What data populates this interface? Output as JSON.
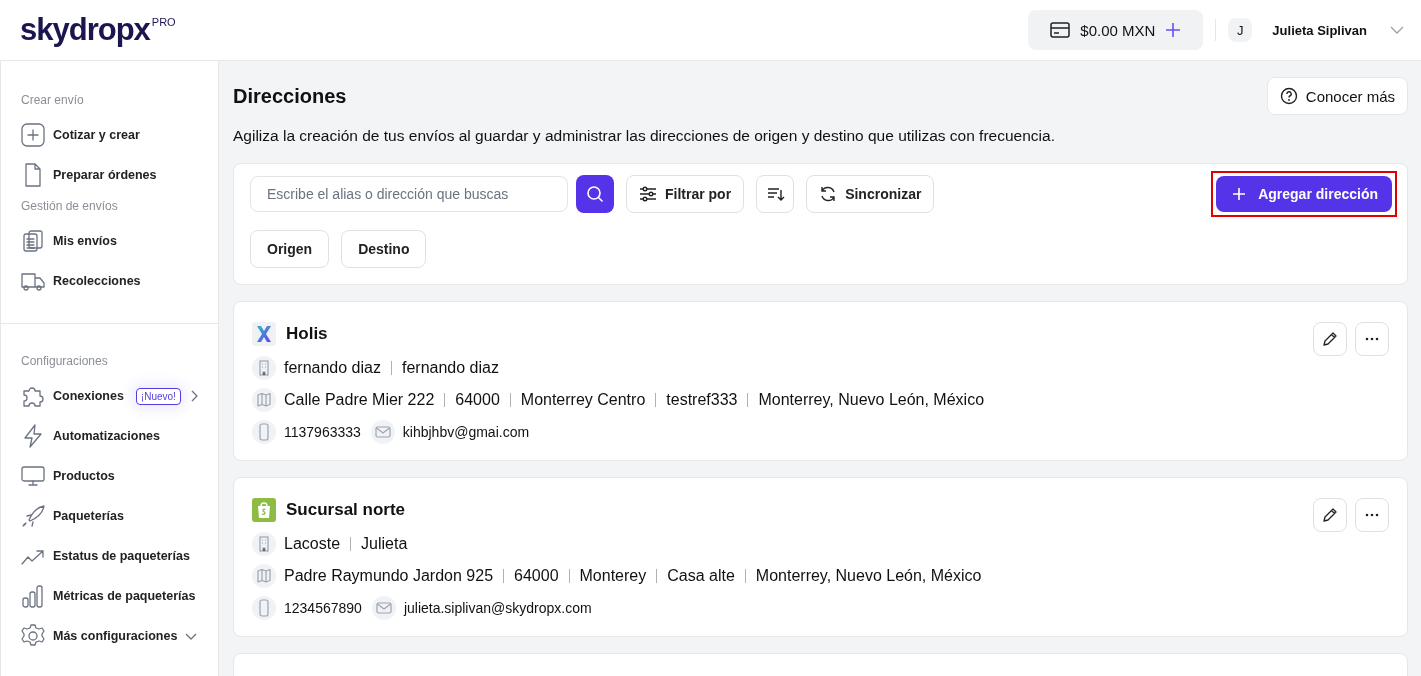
{
  "header": {
    "logo_text": "skydropx",
    "logo_badge": "PRO",
    "balance": "$0.00 MXN",
    "avatar_initial": "J",
    "user_name": "Julieta Siplivan"
  },
  "sidebar": {
    "sections": [
      {
        "title": "Crear envío",
        "items": [
          {
            "kind": "link",
            "label": "Cotizar y crear"
          },
          {
            "kind": "link",
            "label": "Preparar órdenes"
          }
        ]
      },
      {
        "title": "Gestión de envíos",
        "items": [
          {
            "kind": "link",
            "label": "Mis envíos"
          },
          {
            "kind": "link",
            "label": "Recolecciones"
          }
        ]
      },
      {
        "title": "Configuraciones",
        "items": [
          {
            "kind": "flyout",
            "label": "Conexiones",
            "badge": "¡Nuevo!"
          },
          {
            "kind": "link",
            "label": "Automatizaciones"
          },
          {
            "kind": "link",
            "label": "Productos"
          },
          {
            "kind": "link",
            "label": "Paqueterías"
          },
          {
            "kind": "link",
            "label": "Estatus de paqueterías"
          },
          {
            "kind": "link",
            "label": "Métricas de paqueterías"
          },
          {
            "kind": "collapsible",
            "label": "Más configuraciones"
          }
        ]
      }
    ]
  },
  "page": {
    "title": "Direcciones",
    "help_button": "Conocer más",
    "description": "Agiliza la creación de tus envíos al guardar y administrar las direcciones de origen y destino que utilizas con frecuencia."
  },
  "toolbar": {
    "search": {
      "placeholder": "Escribe el alias o dirección que buscas"
    },
    "filter_button": "Filtrar por",
    "sync_button": "Sincronizar",
    "add_button": {
      "label": "Agregar dirección",
      "highlighted": true
    },
    "filters": [
      {
        "label": "Origen"
      },
      {
        "label": "Destino"
      }
    ]
  },
  "addresses": [
    {
      "kind": "skydropx",
      "alias": "Holis",
      "contact": [
        "fernando diaz",
        "fernando diaz"
      ],
      "address": [
        "Calle Padre Mier 222",
        "64000",
        "Monterrey Centro",
        "testref333",
        "Monterrey, Nuevo León, México"
      ],
      "phone": "1137963333",
      "email": "kihbjhbv@gmai.com"
    },
    {
      "kind": "shopify",
      "alias": "Sucursal norte",
      "contact": [
        "Lacoste",
        "Julieta"
      ],
      "address": [
        "Padre Raymundo Jardon 925",
        "64000",
        "Monterey",
        "Casa alte",
        "Monterrey, Nuevo León, México"
      ],
      "phone": "1234567890",
      "email": "julieta.siplivan@skydropx.com"
    }
  ]
}
